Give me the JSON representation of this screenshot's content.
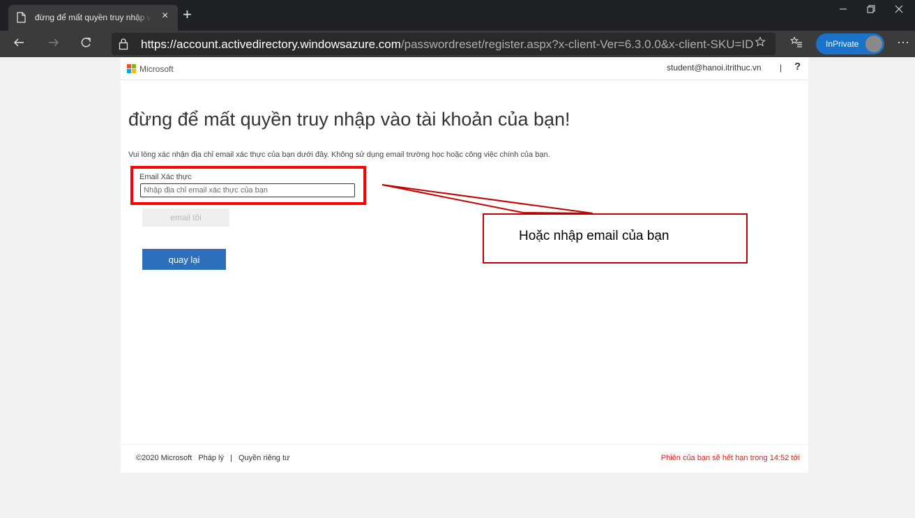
{
  "browser": {
    "tab_title": "đừng để mất quyền truy nhập vào tài khoản của bạn!",
    "tab_close": "×",
    "new_tab": "+",
    "url_scheme": "https://",
    "url_host": "account.activedirectory.windowsazure.com",
    "url_path": "/passwordreset/register.aspx?x-client-Ver=6.3.0.0&x-client-SKU=ID...",
    "inprivate_label": "InPrivate",
    "more_label": "···"
  },
  "header": {
    "logo_text": "Microsoft",
    "user_email": "student@hanoi.itrithuc.vn",
    "separator": "|",
    "help": "?"
  },
  "main": {
    "heading": "đừng để mất quyền truy nhập vào tài khoản của bạn!",
    "description": "Vui lòng xác nhận địa chỉ email xác thực của bạn dưới đây. Không sử dụng email trường học hoặc công việc chính của bạn.",
    "email_label": "Email Xác thực",
    "email_placeholder": "Nhập địa chỉ email xác thực của bạn",
    "email_value": "",
    "email_me_button": "email tôi",
    "back_button": "quay lại"
  },
  "annotation": {
    "callout_text": "Hoặc nhập email của bạn",
    "color": "#ff0000"
  },
  "footer": {
    "copyright": "©2020 Microsoft",
    "legal": "Pháp lý",
    "separator": "|",
    "privacy": "Quyền riêng tư",
    "session": "Phiên của bạn sẽ hết hạn trong 14:52 tới"
  }
}
